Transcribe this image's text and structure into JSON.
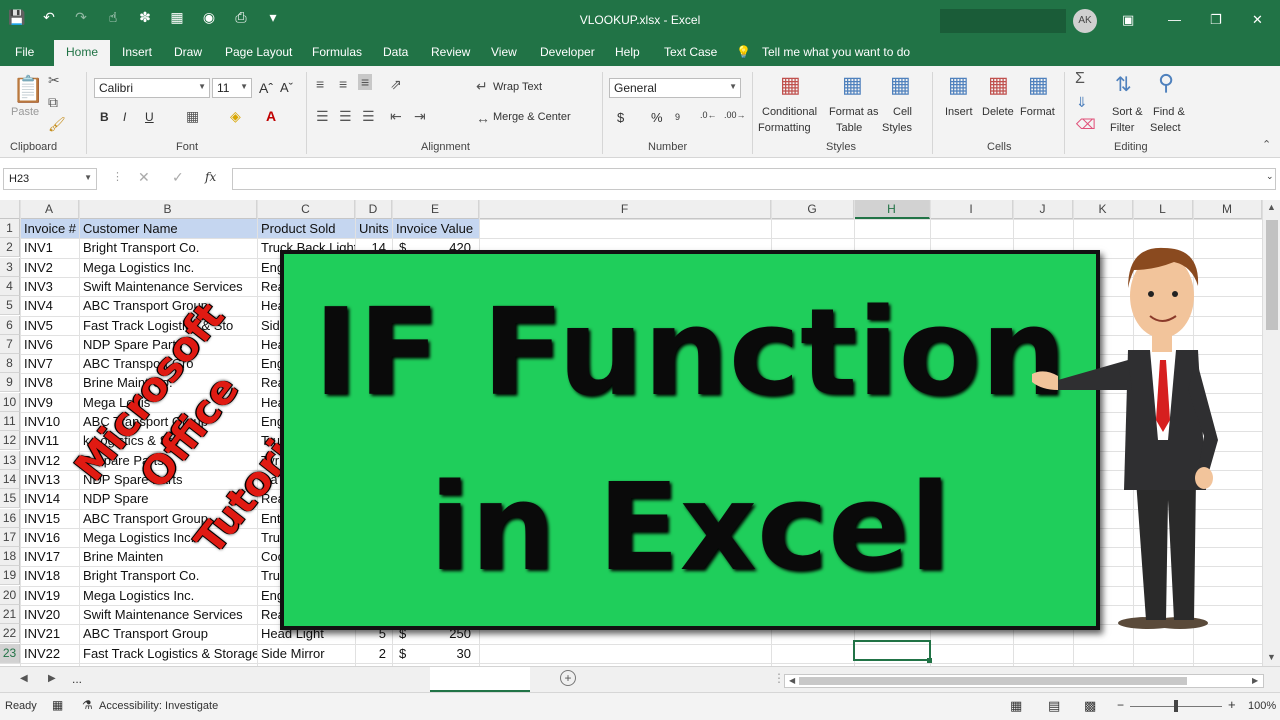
{
  "window": {
    "title": "VLOOKUP.xlsx  -  Excel",
    "user_initials": "AK"
  },
  "tabs": [
    "File",
    "Home",
    "Insert",
    "Draw",
    "Page Layout",
    "Formulas",
    "Data",
    "Review",
    "View",
    "Developer",
    "Help",
    "Text Case"
  ],
  "active_tab": "Home",
  "tell_me": "Tell me what you want to do",
  "ribbon": {
    "clipboard": {
      "paste": "Paste",
      "label": "Clipboard"
    },
    "font": {
      "name": "Calibri",
      "size": "11",
      "label": "Font",
      "bold": "B",
      "italic": "I",
      "underline": "U"
    },
    "alignment": {
      "wrap": "Wrap Text",
      "merge": "Merge & Center",
      "label": "Alignment"
    },
    "number": {
      "format": "General",
      "currency": "$",
      "percent": "%",
      "label": "Number"
    },
    "styles": {
      "conditional_1": "Conditional",
      "conditional_2": "Formatting",
      "format_table_1": "Format as",
      "format_table_2": "Table",
      "cell_styles_1": "Cell",
      "cell_styles_2": "Styles",
      "label": "Styles"
    },
    "cells": {
      "insert": "Insert",
      "delete": "Delete",
      "format": "Format",
      "label": "Cells"
    },
    "editing": {
      "sort_1": "Sort &",
      "sort_2": "Filter",
      "find_1": "Find &",
      "find_2": "Select",
      "label": "Editing"
    }
  },
  "formula_bar": {
    "name_box": "H23",
    "fx": "fx",
    "value": ""
  },
  "columns": [
    "A",
    "B",
    "C",
    "D",
    "E",
    "F",
    "G",
    "H",
    "I",
    "J",
    "K",
    "L",
    "M"
  ],
  "headers": [
    "Invoice #",
    "Customer Name",
    "Product Sold",
    "Units",
    "Invoice Value"
  ],
  "rows": [
    {
      "n": "2",
      "inv": "INV1",
      "cust": "Bright Transport Co.",
      "prod": "Truck Back Light",
      "units": "14",
      "cur": "$",
      "val": "420"
    },
    {
      "n": "3",
      "inv": "INV2",
      "cust": "Mega Logistics Inc.",
      "prod": "Eng",
      "units": "",
      "cur": "",
      "val": ""
    },
    {
      "n": "4",
      "inv": "INV3",
      "cust": "Swift Maintenance Services",
      "prod": "Rea",
      "units": "",
      "cur": "",
      "val": ""
    },
    {
      "n": "5",
      "inv": "INV4",
      "cust": "ABC Transport Group",
      "prod": "Hea",
      "units": "",
      "cur": "",
      "val": ""
    },
    {
      "n": "6",
      "inv": "INV5",
      "cust": "Fast Track Logistics & Sto",
      "prod": "Side",
      "units": "",
      "cur": "",
      "val": ""
    },
    {
      "n": "7",
      "inv": "INV6",
      "cust": "NDP Spare Parts",
      "prod": "Hea",
      "units": "",
      "cur": "",
      "val": ""
    },
    {
      "n": "8",
      "inv": "INV7",
      "cust": "ABC Transport Gro",
      "prod": "Eng",
      "units": "",
      "cur": "",
      "val": ""
    },
    {
      "n": "9",
      "inv": "INV8",
      "cust": "Brine Maint Co.",
      "prod": "Rea",
      "units": "",
      "cur": "",
      "val": ""
    },
    {
      "n": "10",
      "inv": "INV9",
      "cust": "Mega Logis",
      "prod": "Hea",
      "units": "",
      "cur": "",
      "val": ""
    },
    {
      "n": "11",
      "inv": "INV10",
      "cust": "ABC Transport Group",
      "prod": "Eng",
      "units": "",
      "cur": "",
      "val": ""
    },
    {
      "n": "12",
      "inv": "INV11",
      "cust": "k Logistics & Sto",
      "prod": "Tru",
      "units": "",
      "cur": "",
      "val": ""
    },
    {
      "n": "13",
      "inv": "INV12",
      "cust": "P Spare Parts",
      "prod": "Tyr",
      "units": "",
      "cur": "",
      "val": ""
    },
    {
      "n": "14",
      "inv": "INV13",
      "cust": "NDP Spare Parts",
      "prod": "Da",
      "units": "",
      "cur": "",
      "val": ""
    },
    {
      "n": "15",
      "inv": "INV14",
      "cust": "NDP Spare",
      "prod": "Rea",
      "units": "",
      "cur": "",
      "val": ""
    },
    {
      "n": "16",
      "inv": "INV15",
      "cust": "ABC Transport Group",
      "prod": "Ent",
      "units": "",
      "cur": "",
      "val": ""
    },
    {
      "n": "17",
      "inv": "INV16",
      "cust": "Mega Logistics Inc.",
      "prod": "Tru",
      "units": "",
      "cur": "",
      "val": ""
    },
    {
      "n": "18",
      "inv": "INV17",
      "cust": "Brine Mainten",
      "prod": "Coo",
      "units": "",
      "cur": "",
      "val": ""
    },
    {
      "n": "19",
      "inv": "INV18",
      "cust": "Bright Transport Co.",
      "prod": "Tru",
      "units": "",
      "cur": "",
      "val": ""
    },
    {
      "n": "20",
      "inv": "INV19",
      "cust": "Mega Logistics Inc.",
      "prod": "Eng",
      "units": "",
      "cur": "",
      "val": ""
    },
    {
      "n": "21",
      "inv": "INV20",
      "cust": "Swift Maintenance Services",
      "prod": "Rea",
      "units": "",
      "cur": "",
      "val": ""
    },
    {
      "n": "22",
      "inv": "INV21",
      "cust": "ABC Transport Group",
      "prod": "Head Light",
      "units": "5",
      "cur": "$",
      "val": "250"
    },
    {
      "n": "23",
      "inv": "INV22",
      "cust": "Fast Track Logistics & Storage",
      "prod": "Side Mirror",
      "units": "2",
      "cur": "$",
      "val": "30"
    }
  ],
  "overlay": {
    "line1": "IF Function",
    "line2": "in Excel",
    "watermark_1": "Microsoft",
    "watermark_2": "Office",
    "watermark_3": "Tutorials"
  },
  "sheet": {
    "more": "..."
  },
  "status": {
    "ready": "Ready",
    "accessibility": "Accessibility: Investigate",
    "zoom": "100%"
  },
  "colors": {
    "brand": "#217346",
    "card": "#1fce5b",
    "header_fill": "#c5d6f0",
    "watermark": "#e01a12"
  }
}
